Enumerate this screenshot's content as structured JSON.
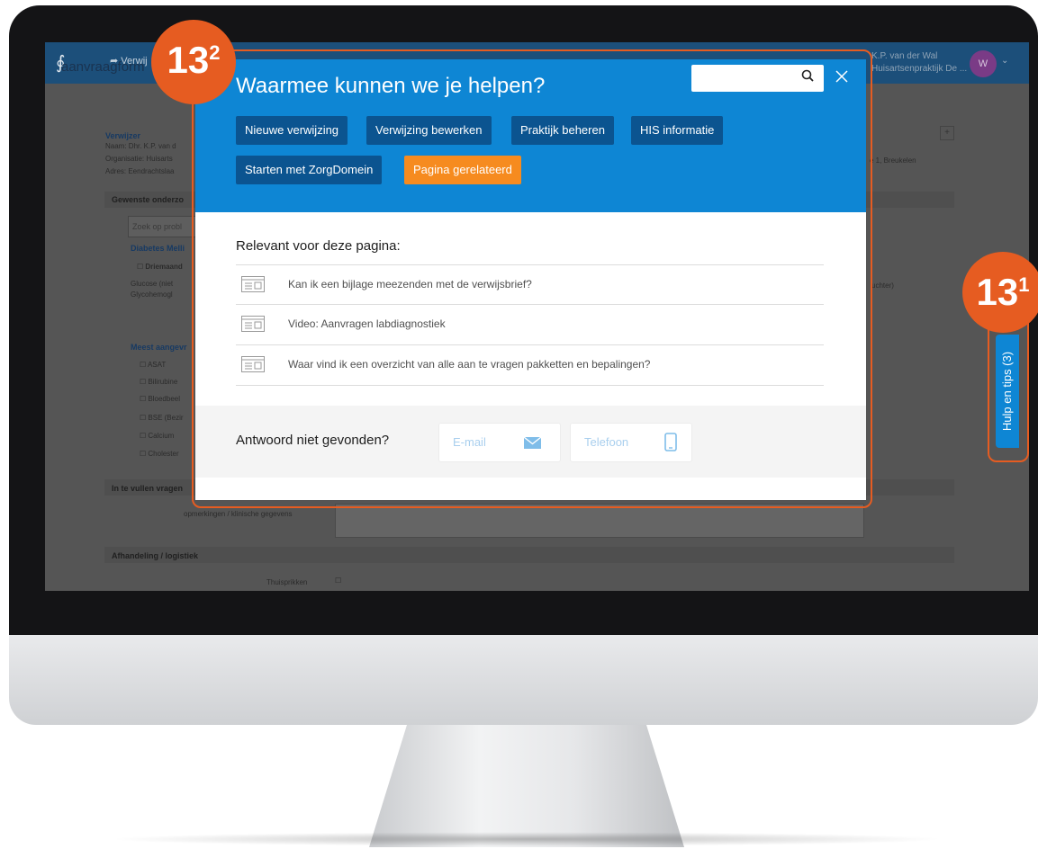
{
  "app": {
    "nav_item": "Verwij",
    "user_name": "K.P. van der Wal",
    "user_org": "Huisartsenpraktijk De ...",
    "avatar_initial": "W"
  },
  "background_page": {
    "title": "aanvraagform",
    "verwijzer_heading": "Verwijzer",
    "verwijzer_lines": [
      "Naam: Dhr. K.P. van d",
      "Organisatie: Huisarts",
      "Adres: Eendrachtslaa"
    ],
    "address_tail": "e 1, Breukelen",
    "gewenste_heading": "Gewenste onderzo",
    "search_placeholder": "Zoek op probl",
    "diabetes_heading": "Diabetes Melli",
    "driemaand": "Driemaand",
    "glucose": "Glucose (niet",
    "glycohemo": "Glycohemogl",
    "nuchter": "uchter)",
    "meest_heading": "Meest aangevr",
    "tests": [
      "ASAT",
      "Bilirubine",
      "Bloedbeel",
      "BSE (Bezir",
      "Calcium",
      "Cholester"
    ],
    "vragen_heading": "In te vullen vragen",
    "opmerkingen_label": "opmerkingen / klinische gegevens",
    "afhandeling_heading": "Afhandeling / logistiek",
    "thuisprikken_label": "Thuisprikken",
    "plus_symbol": "+"
  },
  "help_modal": {
    "title": "Waarmee kunnen we je helpen?",
    "search": {
      "placeholder": "",
      "icon": "search-icon"
    },
    "close_icon": "close-icon",
    "categories": [
      {
        "label": "Nieuwe verwijzing"
      },
      {
        "label": "Verwijzing bewerken"
      },
      {
        "label": "Praktijk beheren"
      },
      {
        "label": "HIS informatie"
      },
      {
        "label": "Starten met ZorgDomein"
      },
      {
        "label": "Pagina gerelateerd",
        "active": true
      }
    ],
    "relevant_title": "Relevant voor deze pagina:",
    "items": [
      {
        "text": "Kan ik een bijlage meezenden met de verwijsbrief?"
      },
      {
        "text": "Video: Aanvragen labdiagnostiek"
      },
      {
        "text": "Waar vind ik een overzicht van alle aan te vragen pakketten en bepalingen?"
      }
    ],
    "footer": {
      "label": "Antwoord niet gevonden?",
      "email_label": "E-mail",
      "phone_label": "Telefoon"
    }
  },
  "help_tab": {
    "label": "Hulp en tips (3)"
  },
  "callouts": [
    {
      "number": "13",
      "sup": "2"
    },
    {
      "number": "13",
      "sup": "1"
    }
  ],
  "colors": {
    "brand_blue": "#0e86d4",
    "dark_blue": "#0b5490",
    "accent_orange": "#f68b1f",
    "callout_orange": "#e65c21"
  }
}
